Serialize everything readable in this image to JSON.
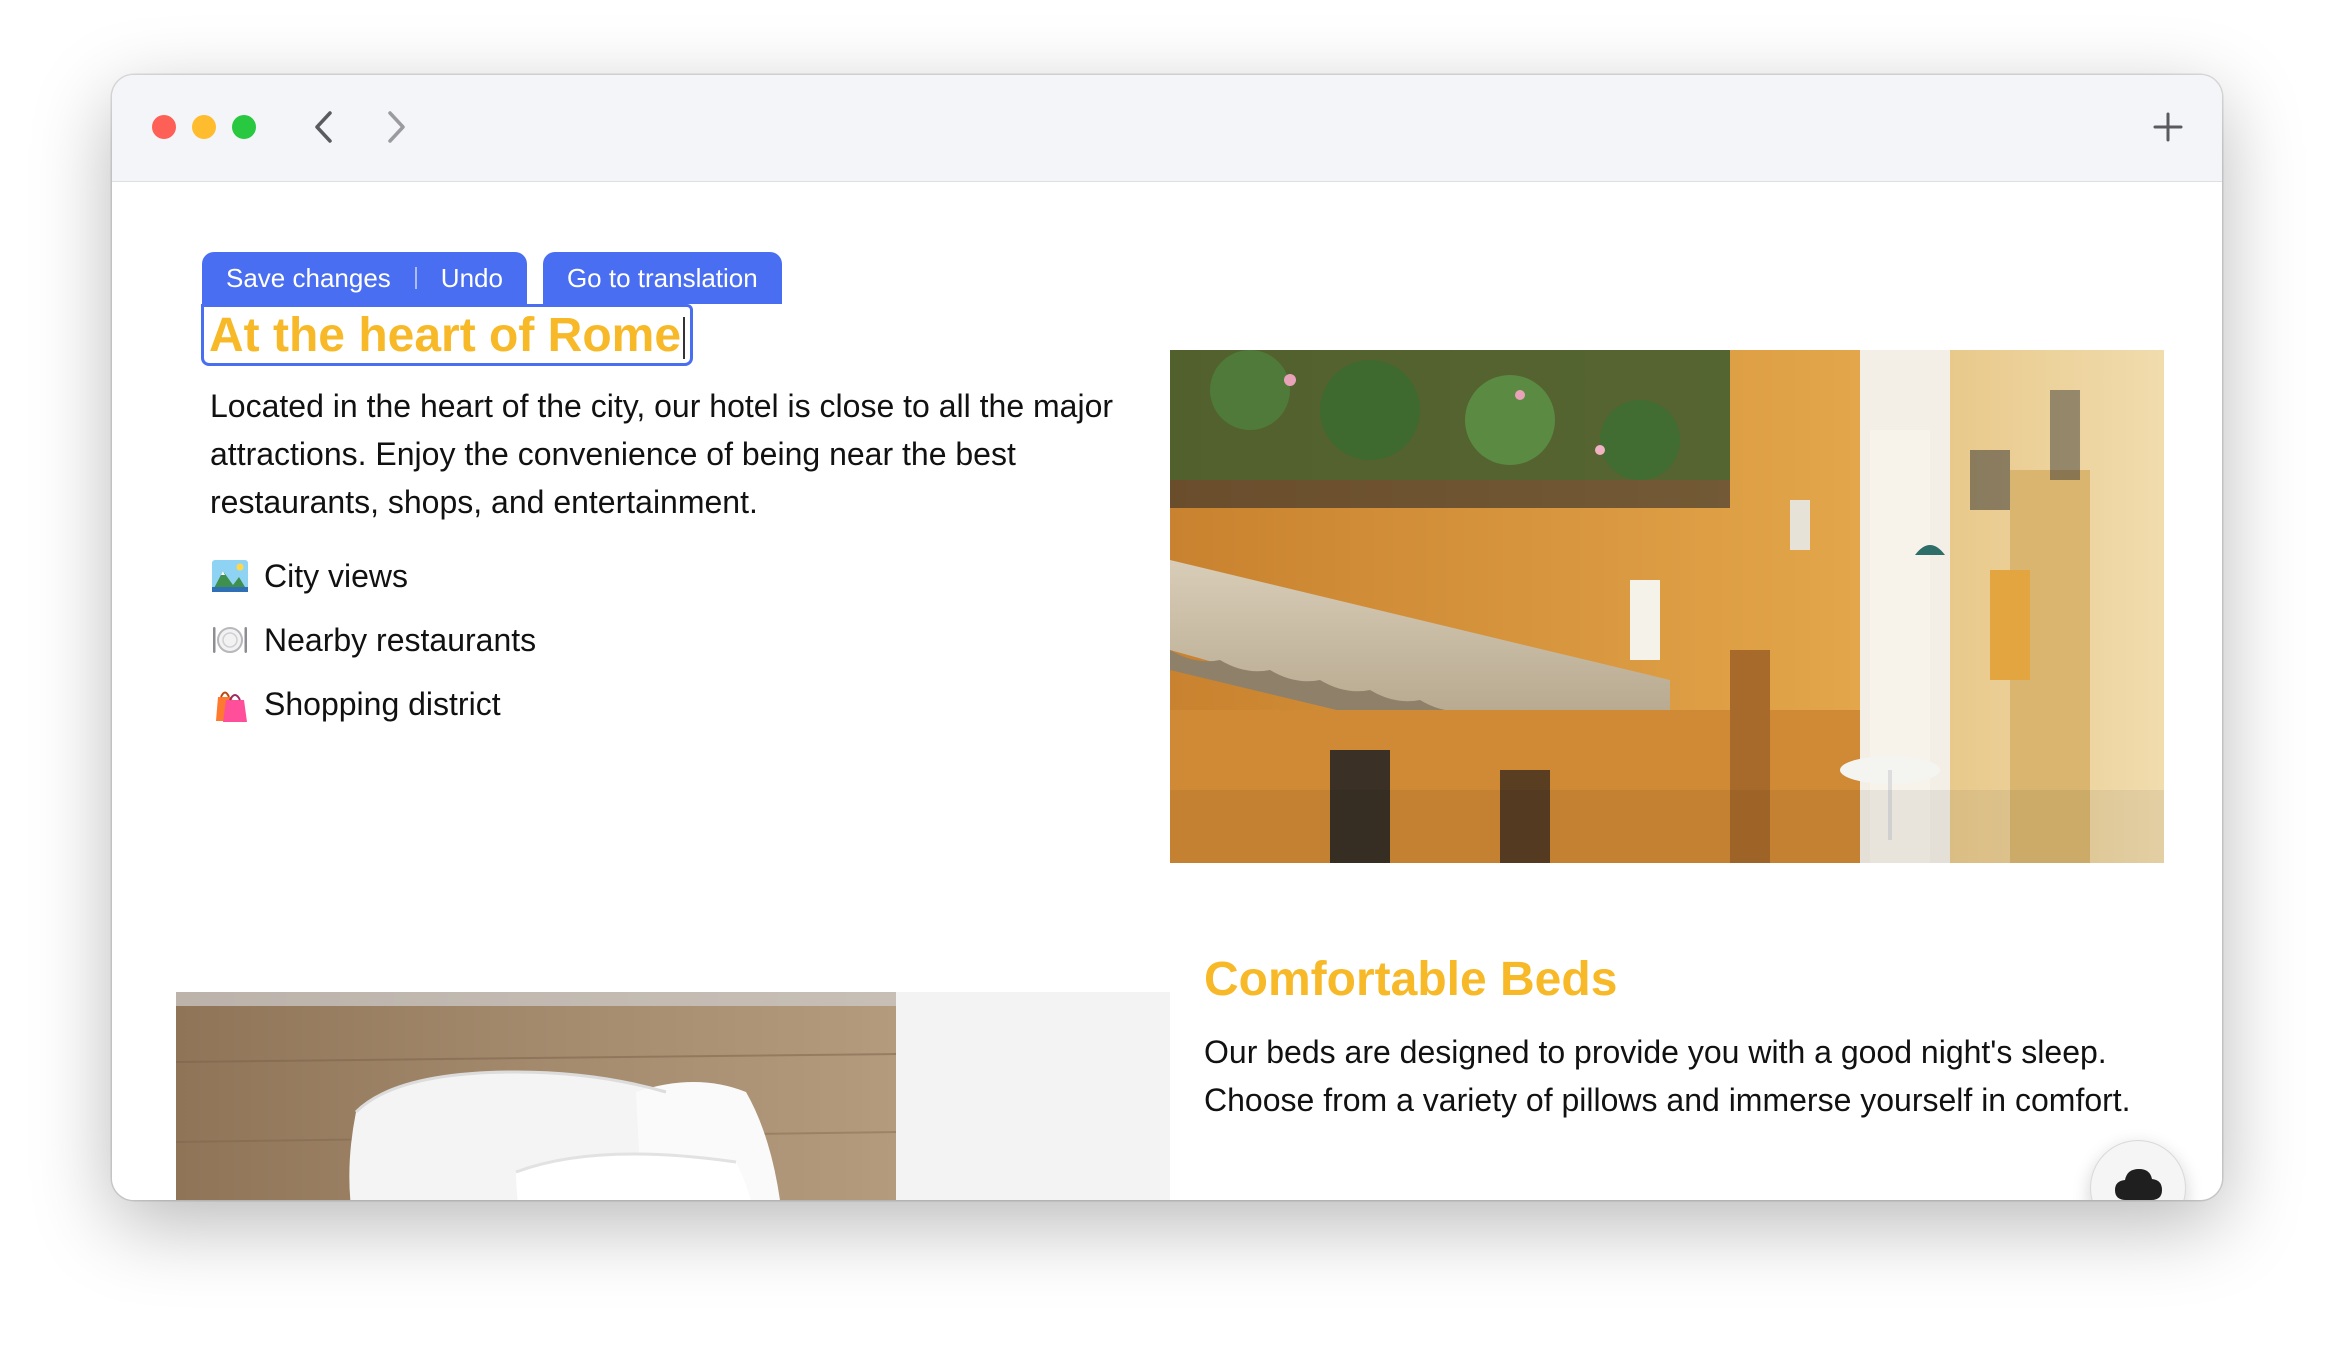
{
  "window": {
    "controls": [
      "close",
      "minimize",
      "zoom"
    ],
    "colors": {
      "close": "#fe5f57",
      "minimize": "#febc2e",
      "zoom": "#28c840"
    }
  },
  "nav": {
    "back_icon": "chevron-left-icon",
    "forward_icon": "chevron-right-icon",
    "new_tab_icon": "plus-icon"
  },
  "toolbar": {
    "save_label": "Save changes",
    "undo_label": "Undo",
    "translate_label": "Go to translation",
    "color": "#4a6ef1"
  },
  "section1": {
    "title": "At the heart of Rome",
    "description": "Located in the heart of the city, our hotel is close to all the major attractions. Enjoy the convenience of being near the best restaurants, shops, and entertainment.",
    "features": [
      {
        "icon": "city-views-icon",
        "label": "City views"
      },
      {
        "icon": "plate-icon",
        "label": "Nearby restaurants"
      },
      {
        "icon": "shopping-bags-icon",
        "label": "Shopping district"
      }
    ],
    "image": "street-photo"
  },
  "section2": {
    "title": "Comfortable Beds",
    "description": "Our beds are designed to provide you with a good night's sleep. Choose from a variety of pillows and immerse yourself in comfort.",
    "image": "bed-photo"
  },
  "fab": {
    "icon": "cloud-icon"
  },
  "accent_color": "#f7b928"
}
